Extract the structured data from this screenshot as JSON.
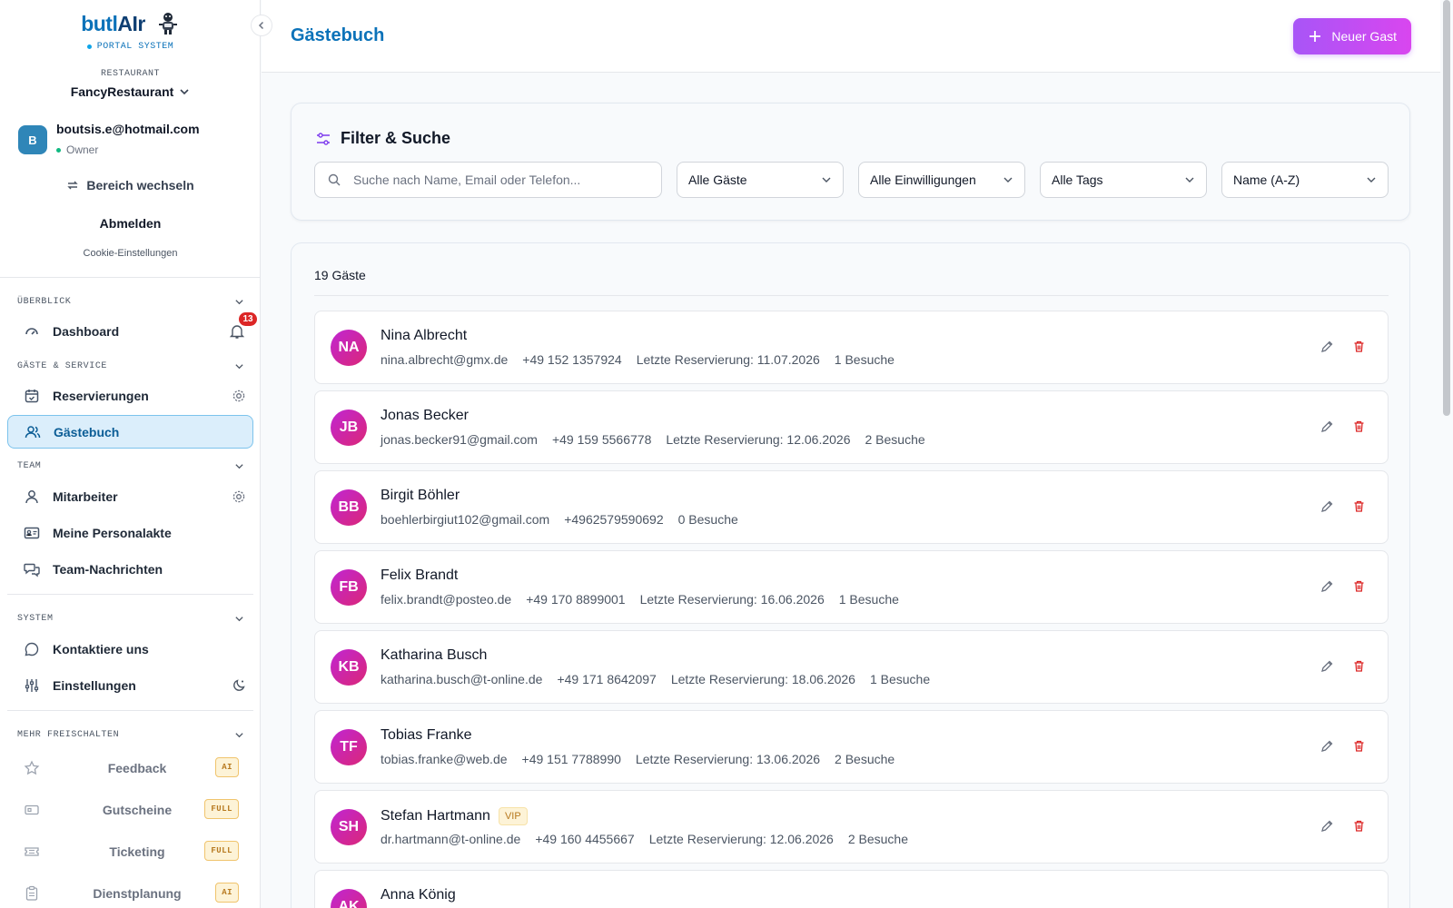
{
  "sidebar": {
    "brand_part1": "butl",
    "brand_part2": "AIr",
    "brand_subtitle": "PORTAL SYSTEM",
    "restaurant_label": "RESTAURANT",
    "restaurant_name": "FancyRestaurant",
    "user_initial": "B",
    "user_email": "boutsis.e@hotmail.com",
    "user_role": "Owner",
    "switch_area": "Bereich wechseln",
    "logout": "Abmelden",
    "cookie_settings": "Cookie-Einstellungen",
    "sections": {
      "overview": "ÜBERBLICK",
      "guests_service": "GÄSTE & SERVICE",
      "team": "TEAM",
      "system": "SYSTEM",
      "unlock": "MEHR FREISCHALTEN"
    },
    "items": {
      "dashboard": "Dashboard",
      "notification_count": "13",
      "reservations": "Reservierungen",
      "guestbook": "Gästebuch",
      "staff": "Mitarbeiter",
      "personnel_file": "Meine Personalakte",
      "team_messages": "Team-Nachrichten",
      "contact": "Kontaktiere uns",
      "settings": "Einstellungen"
    },
    "locked": [
      {
        "label": "Feedback",
        "tag": "AI"
      },
      {
        "label": "Gutscheine",
        "tag": "FULL"
      },
      {
        "label": "Ticketing",
        "tag": "FULL"
      },
      {
        "label": "Dienstplanung",
        "tag": "AI"
      }
    ]
  },
  "header": {
    "title": "Gästebuch",
    "new_guest_label": "Neuer Gast"
  },
  "filter": {
    "title": "Filter & Suche",
    "search_placeholder": "Suche nach Name, Email oder Telefon...",
    "guests_select": "Alle Gäste",
    "consent_select": "Alle Einwilligungen",
    "tags_select": "Alle Tags",
    "sort_select": "Name (A-Z)"
  },
  "list": {
    "count_label": "19 Gäste",
    "guests": [
      {
        "initials": "NA",
        "name": "Nina Albrecht",
        "vip": "",
        "email": "nina.albrecht@gmx.de",
        "phone": "+49 152 1357924",
        "last_res": "Letzte Reservierung: 11.07.2026",
        "visits": "1 Besuche"
      },
      {
        "initials": "JB",
        "name": "Jonas Becker",
        "vip": "",
        "email": "jonas.becker91@gmail.com",
        "phone": "+49 159 5566778",
        "last_res": "Letzte Reservierung: 12.06.2026",
        "visits": "2 Besuche"
      },
      {
        "initials": "BB",
        "name": "Birgit Böhler",
        "vip": "",
        "email": "boehlerbirgiut102@gmail.com",
        "phone": "+4962579590692",
        "last_res": "",
        "visits": "0 Besuche"
      },
      {
        "initials": "FB",
        "name": "Felix Brandt",
        "vip": "",
        "email": "felix.brandt@posteo.de",
        "phone": "+49 170 8899001",
        "last_res": "Letzte Reservierung: 16.06.2026",
        "visits": "1 Besuche"
      },
      {
        "initials": "KB",
        "name": "Katharina Busch",
        "vip": "",
        "email": "katharina.busch@t-online.de",
        "phone": "+49 171 8642097",
        "last_res": "Letzte Reservierung: 18.06.2026",
        "visits": "1 Besuche"
      },
      {
        "initials": "TF",
        "name": "Tobias Franke",
        "vip": "",
        "email": "tobias.franke@web.de",
        "phone": "+49 151 7788990",
        "last_res": "Letzte Reservierung: 13.06.2026",
        "visits": "2 Besuche"
      },
      {
        "initials": "SH",
        "name": "Stefan Hartmann",
        "vip": "VIP",
        "email": "dr.hartmann@t-online.de",
        "phone": "+49 160 4455667",
        "last_res": "Letzte Reservierung: 12.06.2026",
        "visits": "2 Besuche"
      },
      {
        "initials": "AK",
        "name": "Anna König",
        "vip": "",
        "email": "",
        "phone": "",
        "last_res": "",
        "visits": ""
      }
    ]
  },
  "colors": {
    "primary": "#0b72b9",
    "accent_gradient_start": "#a855f7",
    "accent_gradient_end": "#d946ef",
    "danger": "#dc2626",
    "active_nav_bg": "#dbeefb"
  }
}
